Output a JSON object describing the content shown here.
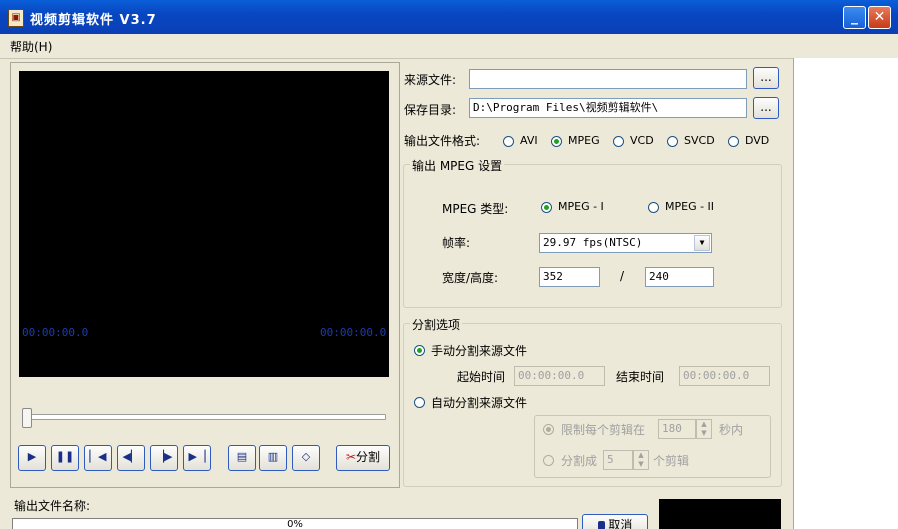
{
  "window": {
    "title": "视频剪辑软件 V3.7",
    "minimize": "_",
    "close": "✕"
  },
  "menu": {
    "help": "帮助(H)"
  },
  "player": {
    "time_start": "00:00:00.0",
    "time_end": "00:00:00.0",
    "split_label": "分割"
  },
  "source": {
    "label": "来源文件:",
    "value": "",
    "browse": "..."
  },
  "save": {
    "label": "保存目录:",
    "value": "D:\\Program Files\\视频剪辑软件\\",
    "browse": "..."
  },
  "format": {
    "label": "输出文件格式:",
    "options": [
      "AVI",
      "MPEG",
      "VCD",
      "SVCD",
      "DVD"
    ],
    "selected": "MPEG"
  },
  "mpeg": {
    "group_title": "输出 MPEG 设置",
    "type_label": "MPEG 类型:",
    "type_options": [
      "MPEG - I",
      "MPEG - II"
    ],
    "type_selected": "MPEG - I",
    "fps_label": "帧率:",
    "fps_value": "29.97 fps(NTSC)",
    "size_label": "宽度/高度:",
    "width": "352",
    "slash": "/",
    "height": "240"
  },
  "split": {
    "group_title": "分割选项",
    "manual_label": "手动分割来源文件",
    "start_label": "起始时间",
    "start_value": "00:00:00.0",
    "end_label": "结束时间",
    "end_value": "00:00:00.0",
    "auto_label": "自动分割来源文件",
    "limit_label": "限制每个剪辑在",
    "limit_value": "180",
    "limit_unit": "秒内",
    "count_label": "分割成",
    "count_value": "5",
    "count_unit": "个剪辑"
  },
  "output": {
    "name_label": "输出文件名称:",
    "progress_text": "0%",
    "progress_percent": 0,
    "cancel_label": "取消"
  }
}
